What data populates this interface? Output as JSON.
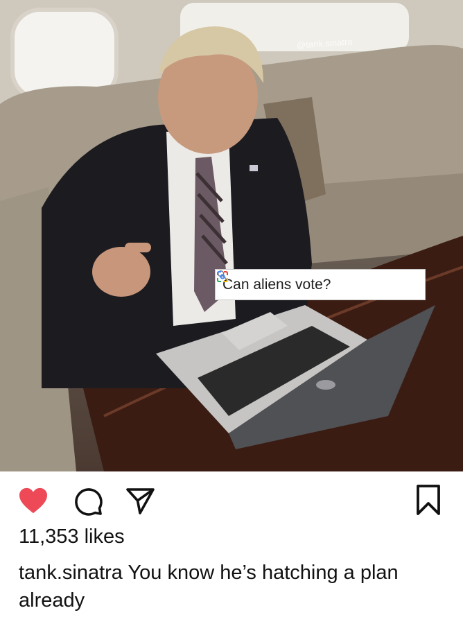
{
  "post": {
    "watermark": "@tank.sinatra",
    "search_query": "Can aliens vote?",
    "liked": true,
    "likes_text": "11,353 likes",
    "username": "tank.sinatra",
    "caption_text": "You know he’s hatching a plan already"
  },
  "icons": {
    "like": "heart-icon",
    "comment": "comment-bubble-icon",
    "share": "paper-plane-icon",
    "save": "bookmark-icon",
    "search": "magnifier-icon",
    "lens": "google-lens-icon"
  },
  "colors": {
    "like_red": "#ed4956",
    "text": "#111111"
  }
}
